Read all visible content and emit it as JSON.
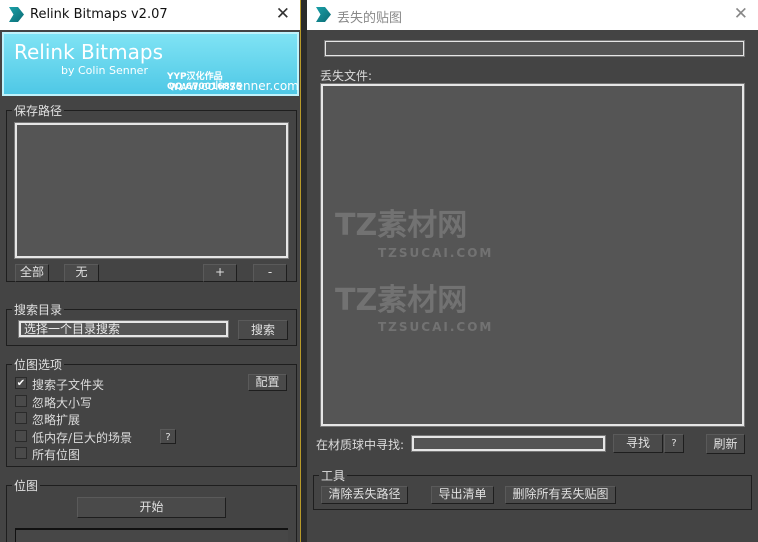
{
  "left_window": {
    "title": "Relink Bitmaps v2.07",
    "banner": {
      "title": "Relink Bitmaps",
      "author": "by Colin Senner",
      "credit": "YYP汉化作品QQ:670016875",
      "url": "www.colinsenner.com"
    },
    "save_path": {
      "label": "保存路径",
      "all": "全部",
      "none": "无",
      "add": "+",
      "remove": "-"
    },
    "search_dir": {
      "label": "搜索目录",
      "value": "选择一个目录搜索",
      "button": "搜索"
    },
    "bitmap_options": {
      "label": "位图选项",
      "config": "配置",
      "help": "?",
      "options": [
        {
          "label": "搜索子文件夹",
          "checked": true
        },
        {
          "label": "忽略大小写",
          "checked": false
        },
        {
          "label": "忽略扩展",
          "checked": false
        },
        {
          "label": "低内存/巨大的场景",
          "checked": false
        },
        {
          "label": "所有位图",
          "checked": false
        }
      ]
    },
    "bitmap": {
      "label": "位图",
      "start": "开始",
      "progress": 0
    }
  },
  "right_window": {
    "title": "丢失的贴图",
    "missing_label": "丢失文件:",
    "find_label": "在材质球中寻找:",
    "find_value": "",
    "find_button": "寻找",
    "help": "?",
    "refresh": "刷新",
    "tools": {
      "label": "工具",
      "clear": "清除丢失路径",
      "export": "导出清单",
      "delete_all": "删除所有丢失贴图"
    }
  },
  "watermark": {
    "brand": "TZ素材网",
    "url": "TZSUCAI.COM"
  },
  "colors": {
    "panel": "#444444",
    "banner": "#5fd3ec"
  }
}
